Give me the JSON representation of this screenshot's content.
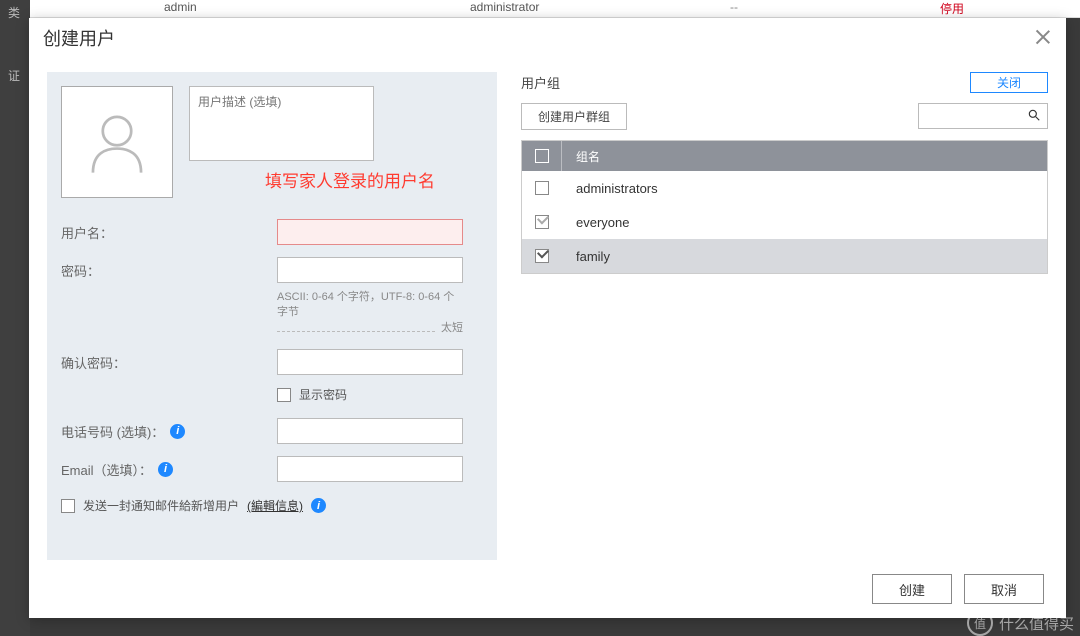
{
  "background": {
    "row": {
      "user": "admin",
      "role": "administrator",
      "dash": "--",
      "status": "停用"
    },
    "sidebar": {
      "item1": "类",
      "item2": "证"
    }
  },
  "dialog": {
    "title": "创建用户",
    "left": {
      "desc_placeholder": "用户描述 (选填)",
      "annotation": "填写家人登录的用户名",
      "labels": {
        "username": "用户名：",
        "password": "密码：",
        "confirm": "确认密码：",
        "phone": "电话号码 (选填)：",
        "email": "Email（选填）："
      },
      "password_hint": "ASCII: 0-64 个字符，UTF-8: 0-64 个字节",
      "too_short": "太短",
      "show_password": "显示密码",
      "send_mail": "发送一封通知邮件給新增用户",
      "edit_info": "(編輯信息)"
    },
    "right": {
      "title": "用户组",
      "close": "关闭",
      "create_group_btn": "创建用户群组",
      "header_name": "组名",
      "rows": [
        {
          "name": "administrators",
          "checked": false,
          "muted": false
        },
        {
          "name": "everyone",
          "checked": true,
          "muted": true
        },
        {
          "name": "family",
          "checked": true,
          "muted": false
        }
      ]
    },
    "footer": {
      "create": "创建",
      "cancel": "取消"
    }
  },
  "watermark": {
    "circ": "值",
    "text": "什么值得买"
  }
}
